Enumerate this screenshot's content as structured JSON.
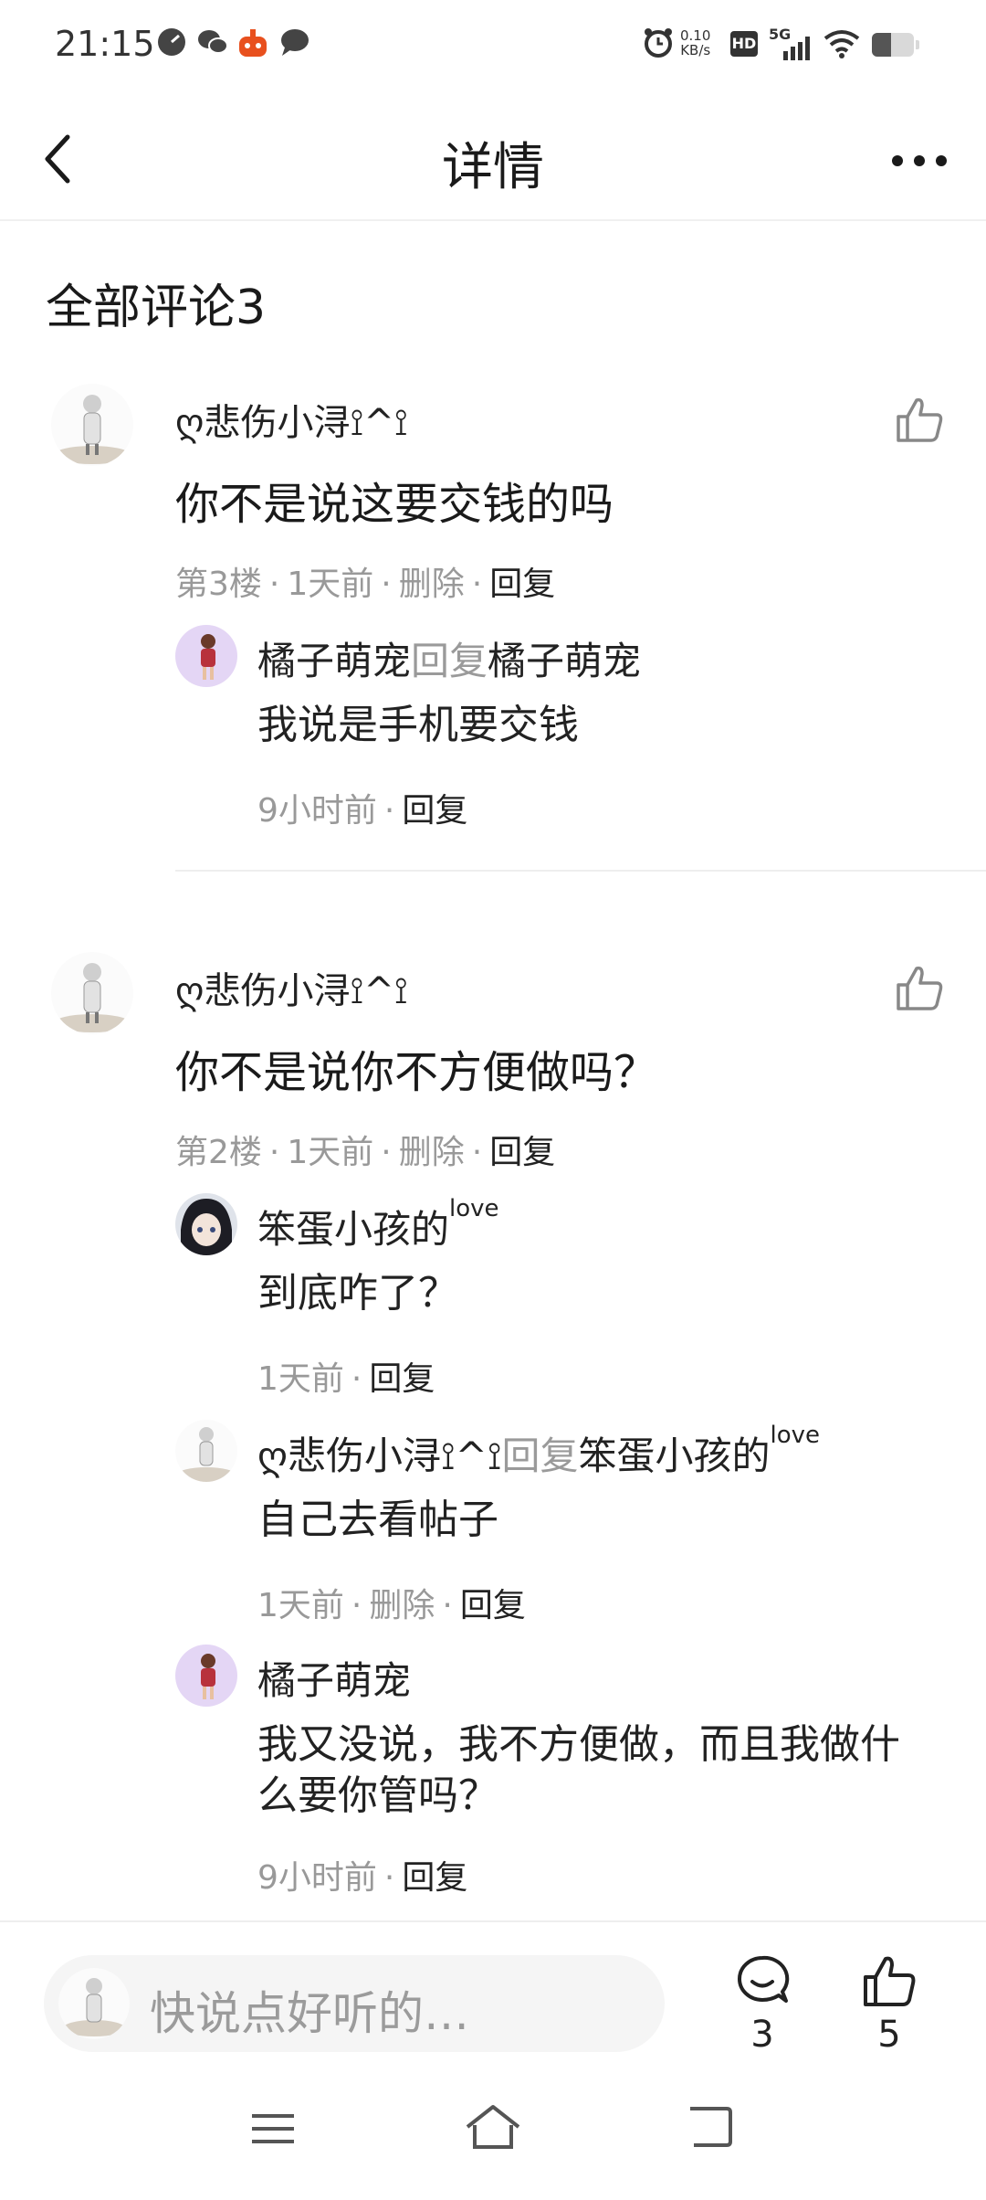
{
  "status_bar": {
    "time": "21:15",
    "net_speed_value": "0.10",
    "net_speed_unit": "KB/s",
    "hd": "HD",
    "network": "5G",
    "battery_level": 0.45,
    "icons": [
      "speedometer-icon",
      "wechat-icon",
      "app-notification-icon",
      "message-icon",
      "alarm-icon",
      "signal-icon",
      "wifi-icon",
      "battery-icon"
    ]
  },
  "header": {
    "title": "详情"
  },
  "comments_section": {
    "title": "全部评论3"
  },
  "comments": [
    {
      "username": "ღ悲伤小浔⟟^⟟",
      "text": "你不是说这要交钱的吗",
      "floor": "第3楼",
      "time": "1天前",
      "delete": "删除",
      "reply": "回复",
      "replies": [
        {
          "name": "橘子萌宠",
          "reply_word": "回复",
          "target": "橘子萌宠",
          "text": "我说是手机要交钱",
          "time": "9小时前",
          "reply": "回复"
        }
      ]
    },
    {
      "username": "ღ悲伤小浔⟟^⟟",
      "text": "你不是说你不方便做吗？",
      "floor": "第2楼",
      "time": "1天前",
      "delete": "删除",
      "reply": "回复",
      "replies": [
        {
          "name": "笨蛋小孩的",
          "name_sup": "love",
          "text": "到底咋了？",
          "time": "1天前",
          "reply": "回复"
        },
        {
          "name": "ღ悲伤小浔⟟^⟟",
          "reply_word": "回复",
          "target": "笨蛋小孩的",
          "target_sup": "love",
          "text": "自己去看帖子",
          "time": "1天前",
          "delete": "删除",
          "reply": "回复"
        },
        {
          "name": "橘子萌宠",
          "text": "我又没说，我不方便做，而且我做什么要你管吗？",
          "time": "9小时前",
          "reply": "回复"
        }
      ]
    }
  ],
  "bottom_bar": {
    "input_placeholder": "快说点好听的…",
    "comment_count": "3",
    "like_count": "5"
  },
  "colors": {
    "primary_text": "#1a1a1a",
    "secondary_text": "#999999",
    "divider": "#eeeeee",
    "input_bg": "#f5f5f5"
  }
}
